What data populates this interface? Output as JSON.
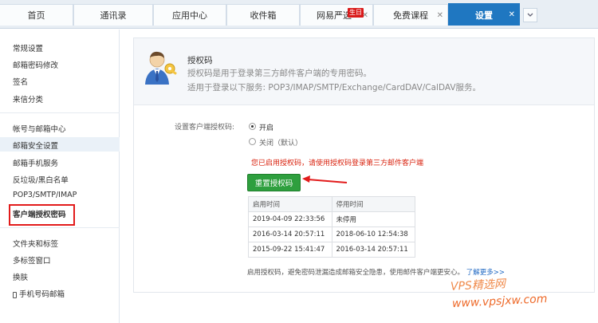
{
  "tabs": [
    {
      "label": "首页"
    },
    {
      "label": "通讯录"
    },
    {
      "label": "应用中心"
    },
    {
      "label": "收件箱"
    },
    {
      "label": "网易严选"
    },
    {
      "label": "免费课程"
    },
    {
      "label": "设置"
    }
  ],
  "badge": "生日",
  "sidebar": {
    "group1": [
      "常规设置",
      "邮箱密码修改",
      "签名",
      "来信分类"
    ],
    "group2": [
      "帐号与邮箱中心",
      "邮箱安全设置",
      "邮箱手机服务",
      "反垃圾/黑白名单",
      "POP3/SMTP/IMAP",
      "客户端授权密码"
    ],
    "group3": [
      "文件夹和标签",
      "多标签窗口",
      "换肤",
      "手机号码邮箱"
    ]
  },
  "header": {
    "title": "授权码",
    "desc": "授权码是用于登录第三方邮件客户端的专用密码。",
    "services": "适用于登录以下服务: POP3/IMAP/SMTP/Exchange/CardDAV/CalDAV服务。"
  },
  "setting": {
    "label": "设置客户端授权码:",
    "on": "开启",
    "off": "关闭（默认）",
    "warning": "您已启用授权码，请使用授权码登录第三方邮件客户端",
    "reset_button": "重置授权码"
  },
  "history": {
    "headers": [
      "启用时间",
      "停用时间"
    ],
    "rows": [
      [
        "2019-04-09 22:33:56",
        "未停用"
      ],
      [
        "2016-03-14 20:57:11",
        "2018-06-10 12:54:38"
      ],
      [
        "2015-09-22 15:41:47",
        "2016-03-14 20:57:11"
      ]
    ]
  },
  "tip": {
    "text": "启用授权码，避免密码泄漏造成邮箱安全隐患，使用邮件客户端更安心。",
    "link": "了解更多>>"
  },
  "watermark": {
    "line1": "VPS精选网",
    "line2": "www.vpsjxw.com"
  },
  "colors": {
    "accent": "#1f77c1",
    "button": "#2e9f3e",
    "warning": "#d9230f",
    "highlight": "#e21b1b"
  }
}
